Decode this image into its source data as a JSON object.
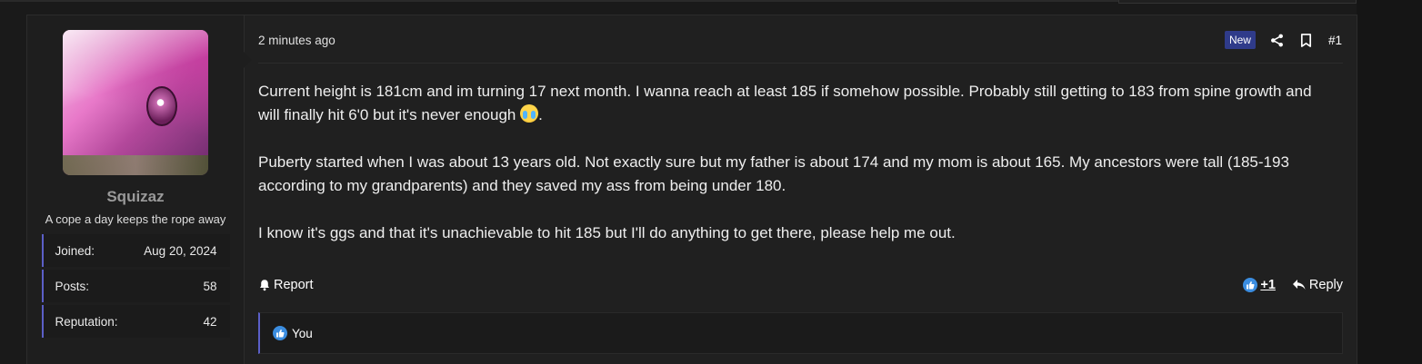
{
  "user": {
    "username": "Squizaz",
    "user_title": "A cope a day keeps the rope away",
    "stats": [
      {
        "label": "Joined:",
        "value": "Aug 20, 2024"
      },
      {
        "label": "Posts:",
        "value": "58"
      },
      {
        "label": "Reputation:",
        "value": "42"
      }
    ]
  },
  "post": {
    "time": "2 minutes ago",
    "badge": "New",
    "number": "#1",
    "paragraphs": [
      "Current height is 181cm and im turning 17 next month. I wanna reach at least 185 if somehow possible. Probably still getting to 183 from spine growth and will finally hit 6'0 but it's never enough",
      "Puberty started when I was about 13 years old. Not exactly sure but my father is about 174 and my mom is about 165. My ancestors were tall (185-193 according to my grandparents) and they saved my ass from being under 180.",
      "I know it's ggs and that it's unachievable to hit 185 but I'll do anything to get there, please help me out."
    ],
    "paragraph1_suffix": "."
  },
  "actions": {
    "report": "Report",
    "like_count": "+1",
    "reply": "Reply"
  },
  "reactions": {
    "label": "You"
  },
  "icons": {
    "share": "share-icon",
    "bookmark": "bookmark-icon",
    "bell": "bell-icon",
    "like": "thumbs-up-icon",
    "reply": "reply-arrow-icon",
    "emoji": "crying-laughing-emoji"
  },
  "colors": {
    "accent": "#5b5fc7",
    "badge_bg": "#2f3b8a",
    "like_blue": "#3b8de0"
  }
}
